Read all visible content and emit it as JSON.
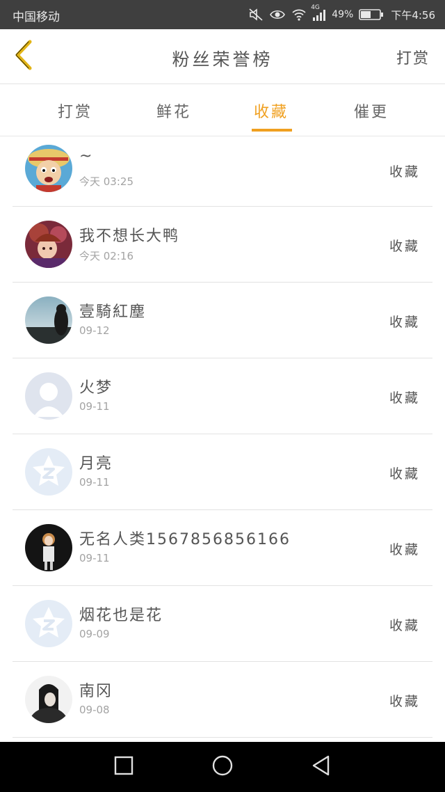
{
  "status_bar": {
    "carrier": "中国移动",
    "network": "4G",
    "battery": "49%",
    "time": "下午4:56"
  },
  "header": {
    "back_icon": "chevron-left-icon",
    "title": "粉丝荣誉榜",
    "action": "打赏"
  },
  "tabs": [
    {
      "label": "打赏",
      "active": false
    },
    {
      "label": "鲜花",
      "active": false
    },
    {
      "label": "收藏",
      "active": true
    },
    {
      "label": "催更",
      "active": false
    }
  ],
  "accent_color": "#f0a020",
  "list": [
    {
      "name": "~",
      "time": "今天 03:25",
      "action": "收藏",
      "avatar": "cartoon-avatar"
    },
    {
      "name": "我不想长大鸭",
      "time": "今天 02:16",
      "action": "收藏",
      "avatar": "anime-avatar"
    },
    {
      "name": "壹騎紅塵",
      "time": "09-12",
      "action": "收藏",
      "avatar": "silhouette-avatar"
    },
    {
      "name": "火梦",
      "time": "09-11",
      "action": "收藏",
      "avatar": "default-person-avatar"
    },
    {
      "name": "月亮",
      "time": "09-11",
      "action": "收藏",
      "avatar": "default-qq-star-avatar"
    },
    {
      "name": "无名人类1567856856166",
      "time": "09-11",
      "action": "收藏",
      "avatar": "anime-girl-avatar"
    },
    {
      "name": "烟花也是花",
      "time": "09-09",
      "action": "收藏",
      "avatar": "default-qq-star-avatar"
    },
    {
      "name": "南冈",
      "time": "09-08",
      "action": "收藏",
      "avatar": "portrait-avatar"
    }
  ],
  "nav_bar": {
    "recent": "square-icon",
    "home": "circle-icon",
    "back": "triangle-back-icon"
  }
}
